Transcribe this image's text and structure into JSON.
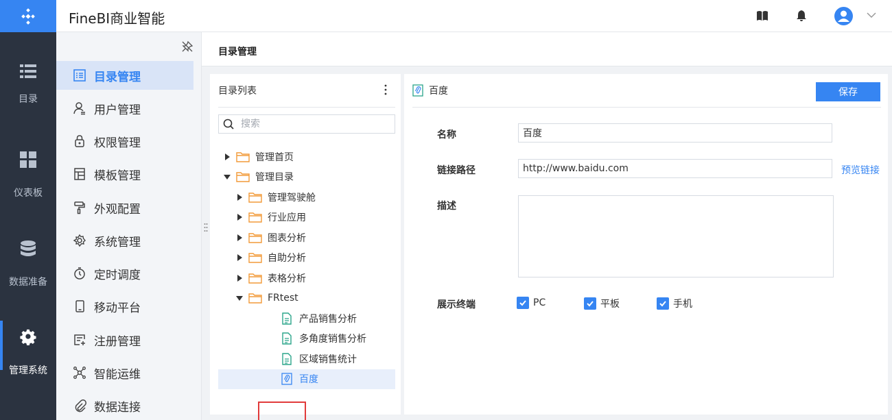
{
  "app": {
    "title": "FineBI商业智能"
  },
  "rail": {
    "items": [
      {
        "label": "目录",
        "icon": "list-icon"
      },
      {
        "label": "仪表板",
        "icon": "dashboard-icon"
      },
      {
        "label": "数据准备",
        "icon": "database-icon"
      },
      {
        "label": "管理系统",
        "icon": "gear-icon",
        "active": true
      }
    ]
  },
  "sidebar": {
    "items": [
      {
        "label": "目录管理",
        "icon": "catalog-icon",
        "active": true
      },
      {
        "label": "用户管理",
        "icon": "user-icon"
      },
      {
        "label": "权限管理",
        "icon": "lock-icon"
      },
      {
        "label": "模板管理",
        "icon": "template-icon"
      },
      {
        "label": "外观配置",
        "icon": "paint-roller-icon"
      },
      {
        "label": "系统管理",
        "icon": "settings-icon"
      },
      {
        "label": "定时调度",
        "icon": "timer-icon"
      },
      {
        "label": "移动平台",
        "icon": "mobile-icon"
      },
      {
        "label": "注册管理",
        "icon": "register-icon"
      },
      {
        "label": "智能运维",
        "icon": "network-icon"
      },
      {
        "label": "数据连接",
        "icon": "paperclip-icon"
      }
    ]
  },
  "page": {
    "title": "目录管理"
  },
  "tree": {
    "header": "目录列表",
    "search_placeholder": "搜索",
    "nodes": [
      {
        "label": "管理首页",
        "type": "folder",
        "level": 0,
        "expanded": false
      },
      {
        "label": "管理目录",
        "type": "folder",
        "level": 0,
        "expanded": true
      },
      {
        "label": "管理驾驶舱",
        "type": "folder",
        "level": 1,
        "expanded": false
      },
      {
        "label": "行业应用",
        "type": "folder",
        "level": 1,
        "expanded": false
      },
      {
        "label": "图表分析",
        "type": "folder",
        "level": 1,
        "expanded": false
      },
      {
        "label": "自助分析",
        "type": "folder",
        "level": 1,
        "expanded": false
      },
      {
        "label": "表格分析",
        "type": "folder",
        "level": 1,
        "expanded": false
      },
      {
        "label": "FRtest",
        "type": "folder",
        "level": 1,
        "expanded": true
      },
      {
        "label": "产品销售分析",
        "type": "doc",
        "level": 2
      },
      {
        "label": "多角度销售分析",
        "type": "doc",
        "level": 2
      },
      {
        "label": "区域销售统计",
        "type": "doc",
        "level": 2
      },
      {
        "label": "百度",
        "type": "link",
        "level": 2,
        "selected": true
      }
    ]
  },
  "detail": {
    "title": "百度",
    "save_label": "保存",
    "name_label": "名称",
    "name_value": "百度",
    "path_label": "链接路径",
    "path_value": "http://www.baidu.com",
    "preview_label": "预览链接",
    "desc_label": "描述",
    "desc_value": "",
    "terminal_label": "展示终端",
    "terminals": [
      {
        "label": "PC",
        "checked": true
      },
      {
        "label": "平板",
        "checked": true
      },
      {
        "label": "手机",
        "checked": true
      }
    ]
  },
  "colors": {
    "accent": "#3685f2",
    "rail_bg": "#2b3340",
    "folder": "#f29a38",
    "doc": "#2aa58a",
    "highlight": "#e13a3a"
  }
}
